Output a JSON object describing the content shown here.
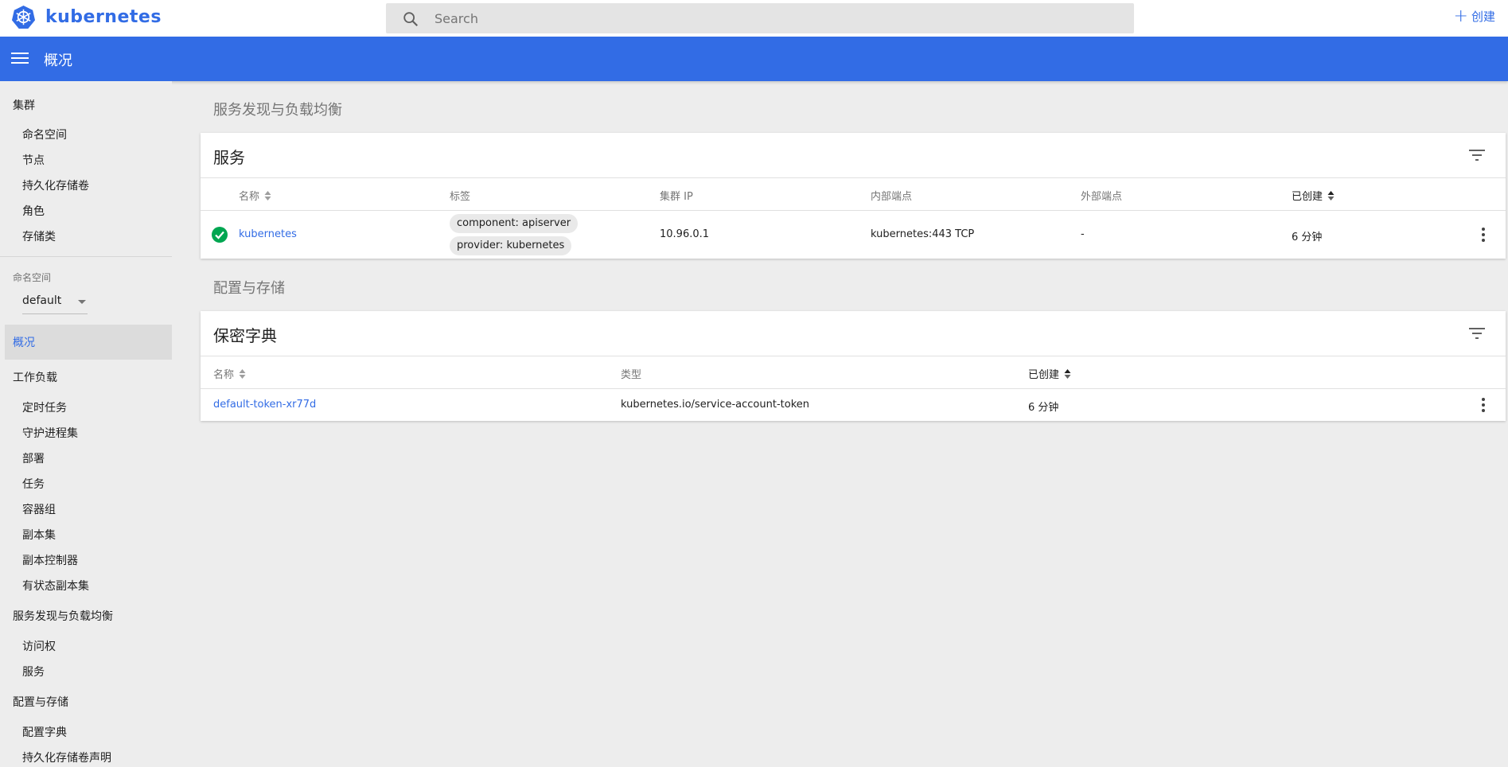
{
  "app": {
    "brand": "kubernetes",
    "search_placeholder": "Search",
    "create_label": "创建",
    "colors": {
      "primary": "#326ce5",
      "success": "#00a651"
    }
  },
  "titlebar": {
    "title": "概况"
  },
  "sidebar": {
    "cluster_group": "集群",
    "cluster_items": [
      "命名空间",
      "节点",
      "持久化存储卷",
      "角色",
      "存储类"
    ],
    "namespace_label": "命名空间",
    "namespace_value": "default",
    "overview": "概况",
    "workloads_group": "工作负载",
    "workloads_items": [
      "定时任务",
      "守护进程集",
      "部署",
      "任务",
      "容器组",
      "副本集",
      "副本控制器",
      "有状态副本集"
    ],
    "discovery_group": "服务发现与负载均衡",
    "discovery_items": [
      "访问权",
      "服务"
    ],
    "config_group": "配置与存储",
    "config_items": [
      "配置字典",
      "持久化存储卷声明"
    ]
  },
  "main": {
    "discovery_section": "服务发现与负载均衡",
    "services_card": {
      "title": "服务",
      "columns": [
        "名称",
        "标签",
        "集群 IP",
        "内部端点",
        "外部端点",
        "已创建"
      ],
      "rows": [
        {
          "status": "ok",
          "name": "kubernetes",
          "labels": [
            "component: apiserver",
            "provider: kubernetes"
          ],
          "cluster_ip": "10.96.0.1",
          "internal_endpoint": "kubernetes:443 TCP",
          "external_endpoint": "-",
          "created": "6 分钟"
        }
      ]
    },
    "config_section": "配置与存储",
    "secrets_card": {
      "title": "保密字典",
      "columns": [
        "名称",
        "类型",
        "已创建"
      ],
      "rows": [
        {
          "name": "default-token-xr77d",
          "type": "kubernetes.io/service-account-token",
          "created": "6 分钟"
        }
      ]
    }
  }
}
